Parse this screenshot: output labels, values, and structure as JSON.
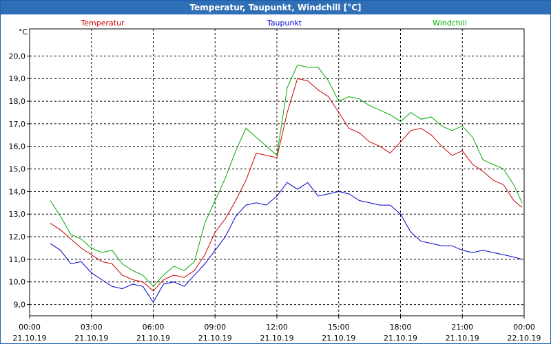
{
  "window": {
    "title": "Temperatur, Taupunkt, Windchill [°C]"
  },
  "chart_data": {
    "type": "line",
    "title": "Temperatur, Taupunkt, Windchill [°C]",
    "ylabel": "°C",
    "ylim": [
      8.5,
      21.2
    ],
    "yticks": [
      "9,0",
      "10,0",
      "11,0",
      "12,0",
      "13,0",
      "14,0",
      "15,0",
      "16,0",
      "17,0",
      "18,0",
      "19,0",
      "20,0"
    ],
    "xlim": [
      0,
      24
    ],
    "xticks": [
      {
        "time": "00:00",
        "date": "21.10.19"
      },
      {
        "time": "03:00",
        "date": "21.10.19"
      },
      {
        "time": "06:00",
        "date": "21.10.19"
      },
      {
        "time": "09:00",
        "date": "21.10.19"
      },
      {
        "time": "12:00",
        "date": "21.10.19"
      },
      {
        "time": "15:00",
        "date": "21.10.19"
      },
      {
        "time": "18:00",
        "date": "21.10.19"
      },
      {
        "time": "21:00",
        "date": "21.10.19"
      },
      {
        "time": "00:00",
        "date": "22.10.19"
      }
    ],
    "grid": true,
    "legend_position": "top",
    "x": [
      1.0,
      1.5,
      2.0,
      2.5,
      3.0,
      3.5,
      4.0,
      4.5,
      5.0,
      5.5,
      6.0,
      6.5,
      7.0,
      7.5,
      8.0,
      8.5,
      9.0,
      9.5,
      10.0,
      10.5,
      11.0,
      11.5,
      12.0,
      12.5,
      13.0,
      13.5,
      14.0,
      14.5,
      15.0,
      15.5,
      16.0,
      16.5,
      17.0,
      17.5,
      18.0,
      18.5,
      19.0,
      19.5,
      20.0,
      20.5,
      21.0,
      21.5,
      22.0,
      22.5,
      23.0,
      23.5,
      23.9
    ],
    "series": [
      {
        "name": "Temperatur",
        "color": "#cc0000",
        "values": [
          12.6,
          12.3,
          11.9,
          11.5,
          11.2,
          10.9,
          10.8,
          10.3,
          10.1,
          10.0,
          9.6,
          10.1,
          10.3,
          10.2,
          10.5,
          11.2,
          12.2,
          12.8,
          13.6,
          14.5,
          15.7,
          15.6,
          15.5,
          17.5,
          19.0,
          18.9,
          18.5,
          18.2,
          17.5,
          16.8,
          16.6,
          16.2,
          16.0,
          15.7,
          16.2,
          16.7,
          16.8,
          16.5,
          16.0,
          15.6,
          15.8,
          15.2,
          14.9,
          14.5,
          14.3,
          13.6,
          13.3
        ]
      },
      {
        "name": "Taupunkt",
        "color": "#0000cc",
        "values": [
          11.7,
          11.4,
          10.8,
          10.9,
          10.4,
          10.1,
          9.8,
          9.7,
          9.9,
          9.8,
          9.1,
          9.9,
          10.0,
          9.8,
          10.3,
          10.8,
          11.4,
          12.0,
          12.9,
          13.4,
          13.5,
          13.4,
          13.8,
          14.4,
          14.1,
          14.4,
          13.8,
          13.9,
          14.0,
          13.9,
          13.6,
          13.5,
          13.4,
          13.4,
          13.0,
          12.2,
          11.8,
          11.7,
          11.6,
          11.6,
          11.4,
          11.3,
          11.4,
          11.3,
          11.2,
          11.1,
          11.0
        ]
      },
      {
        "name": "Windchill",
        "color": "#00aa00",
        "values": [
          13.6,
          12.9,
          12.1,
          11.9,
          11.5,
          11.3,
          11.4,
          10.8,
          10.5,
          10.3,
          9.8,
          10.3,
          10.7,
          10.5,
          10.9,
          12.6,
          13.6,
          14.6,
          15.8,
          16.8,
          16.4,
          16.0,
          15.6,
          18.6,
          19.6,
          19.5,
          19.5,
          18.9,
          18.0,
          18.2,
          18.1,
          17.8,
          17.6,
          17.4,
          17.1,
          17.5,
          17.2,
          17.3,
          16.9,
          16.7,
          16.9,
          16.4,
          15.4,
          15.2,
          15.0,
          14.3,
          13.5
        ]
      }
    ]
  }
}
